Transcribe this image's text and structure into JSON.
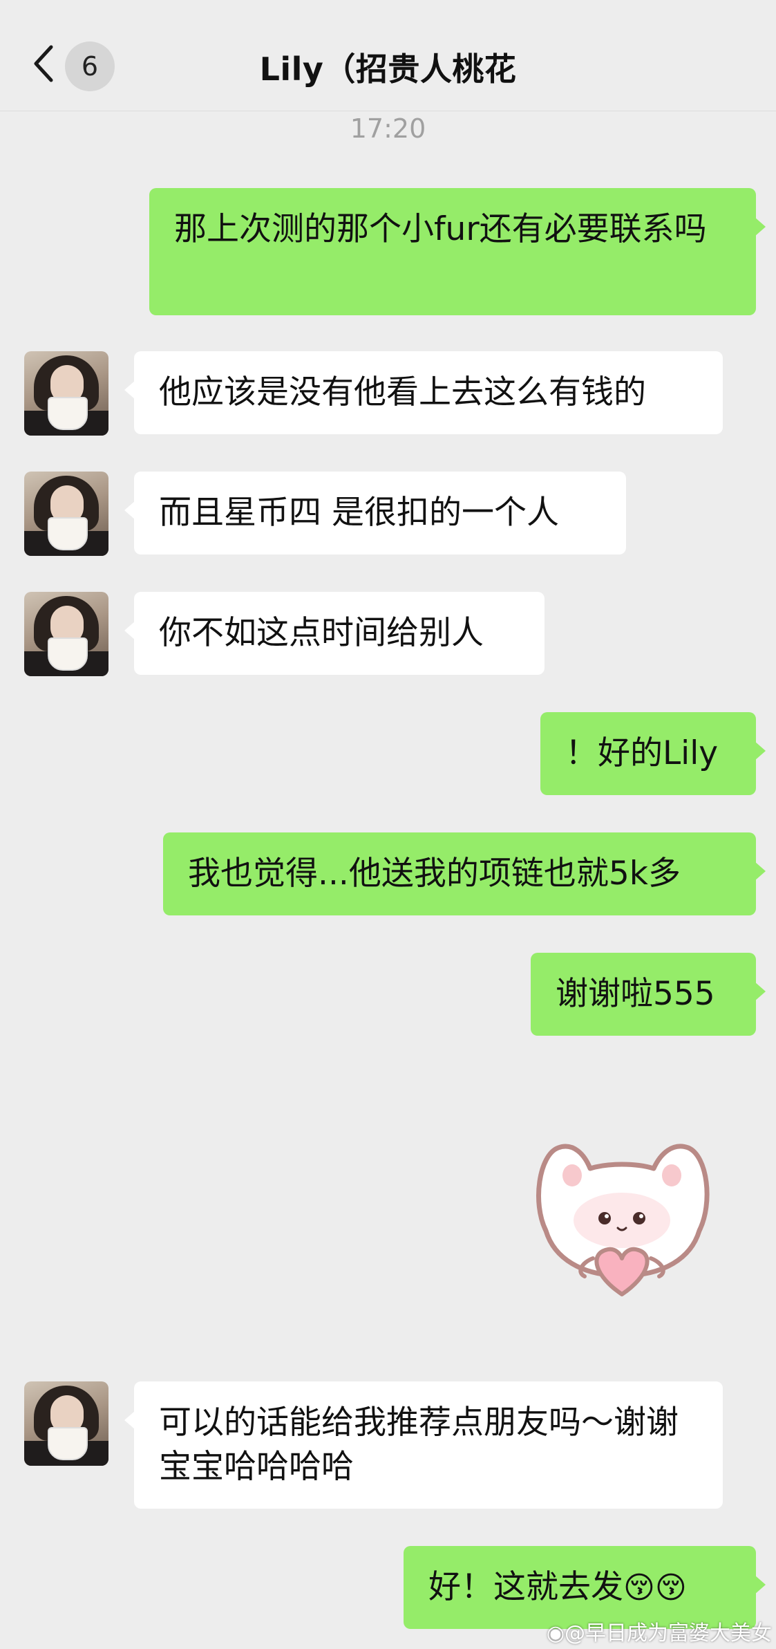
{
  "header": {
    "back_count": "6",
    "title": "Lily（招贵人桃花"
  },
  "timestamp": "17:20",
  "messages": [
    {
      "from": "me",
      "text": "那上次测的那个小fur还有必要联系吗"
    },
    {
      "from": "them",
      "text": "他应该是没有他看上去这么有钱的"
    },
    {
      "from": "them",
      "text": "而且星币四 是很扣的一个人"
    },
    {
      "from": "them",
      "text": "你不如这点时间给别人"
    },
    {
      "from": "me",
      "text": "！好的Lily"
    },
    {
      "from": "me",
      "text": "我也觉得...他送我的项链也就5k多"
    },
    {
      "from": "me",
      "text": "谢谢啦555"
    },
    {
      "from": "me",
      "type": "sticker",
      "sticker": "cat-heart-sticker"
    },
    {
      "from": "them",
      "text": "可以的话能给我推荐点朋友吗～谢谢宝宝哈哈哈哈"
    },
    {
      "from": "me",
      "text": "好！这就去发",
      "emojis": "😚😚"
    }
  ],
  "watermark": "@早日成为富婆大美女",
  "icons": {
    "back": "chevron-left-icon",
    "weibo": "weibo-icon"
  },
  "colors": {
    "background": "#ededed",
    "my_bubble": "#95ec69",
    "their_bubble": "#ffffff"
  }
}
